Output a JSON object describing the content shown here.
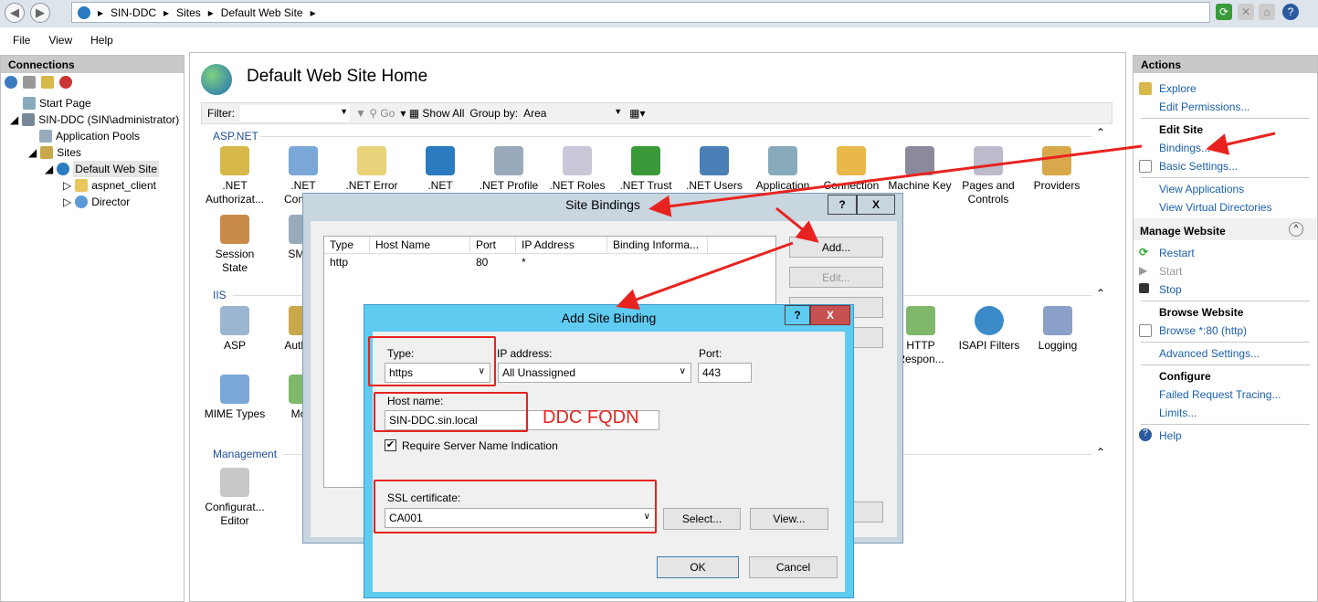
{
  "breadcrumb": [
    "SIN-DDC",
    "Sites",
    "Default Web Site"
  ],
  "menu": [
    "File",
    "View",
    "Help"
  ],
  "connections": {
    "title": "Connections",
    "tree": [
      "Start Page",
      "SIN-DDC (SIN\\administrator)",
      "Application Pools",
      "Sites",
      "Default Web Site",
      "aspnet_client",
      "Director"
    ]
  },
  "center": {
    "title": "Default Web Site Home",
    "filter_label": "Filter:",
    "go_label": "Go",
    "show_all_label": "Show All",
    "group_by_label": "Group by:",
    "group_by_value": "Area",
    "sections": {
      "aspnet": "ASP.NET",
      "iis": "IIS",
      "management": "Management"
    },
    "aspnet_features": [
      ".NET Authorizat...",
      ".NET Comp...",
      ".NET Error",
      ".NET",
      ".NET Profile",
      ".NET Roles",
      ".NET Trust",
      ".NET Users",
      "Application",
      "Connection",
      "Machine Key",
      "Pages and Controls",
      "Providers"
    ],
    "aspnet_row2": [
      "Session State",
      "SMTP"
    ],
    "iis_features": [
      "ASP",
      "Authe...",
      "HTTP Respon...",
      "ISAPI Filters",
      "Logging"
    ],
    "iis_row2": [
      "MIME Types",
      "Mo..."
    ],
    "management_features": [
      "Configurat... Editor"
    ]
  },
  "actions": {
    "title": "Actions",
    "explore": "Explore",
    "edit_permissions": "Edit Permissions...",
    "edit_site": "Edit Site",
    "bindings": "Bindings...",
    "basic_settings": "Basic Settings...",
    "view_applications": "View Applications",
    "view_virtual_directories": "View Virtual Directories",
    "manage_website": "Manage Website",
    "restart": "Restart",
    "start": "Start",
    "stop": "Stop",
    "browse_website": "Browse Website",
    "browse": "Browse *:80 (http)",
    "advanced_settings": "Advanced Settings...",
    "configure": "Configure",
    "failed_request_tracing": "Failed Request Tracing...",
    "limits": "Limits...",
    "help": "Help"
  },
  "site_bindings": {
    "title": "Site Bindings",
    "columns": [
      "Type",
      "Host Name",
      "Port",
      "IP Address",
      "Binding Informa..."
    ],
    "rows": [
      [
        "http",
        "",
        "80",
        "*",
        ""
      ]
    ],
    "add": "Add...",
    "edit": "Edit..."
  },
  "add_binding": {
    "title": "Add Site Binding",
    "type_label": "Type:",
    "type_value": "https",
    "ip_label": "IP address:",
    "ip_value": "All Unassigned",
    "port_label": "Port:",
    "port_value": "443",
    "host_label": "Host name:",
    "host_value": "SIN-DDC.sin.local",
    "sni_label": "Require Server Name Indication",
    "sni_checked": true,
    "ssl_label": "SSL certificate:",
    "ssl_value": "CA001",
    "select": "Select...",
    "view": "View...",
    "ok": "OK",
    "cancel": "Cancel"
  },
  "annotation": "DDC FQDN",
  "colors": {
    "annotation_red": "#e8231f",
    "dialog_title_cyan": "#5fcbf1",
    "link_blue": "#1b5fab"
  }
}
